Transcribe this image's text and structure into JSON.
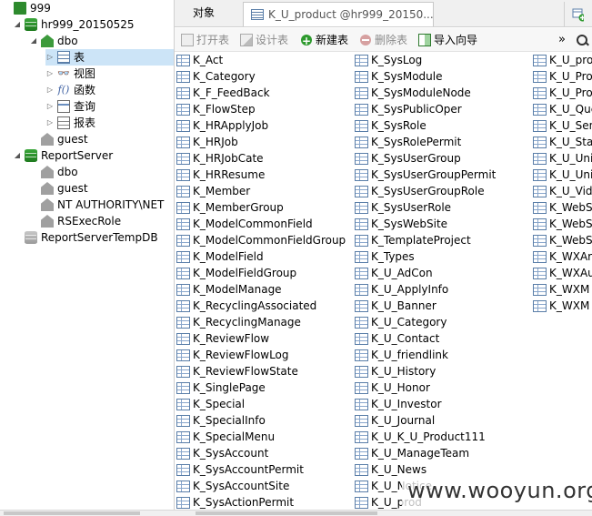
{
  "tree": {
    "nodes": [
      {
        "label": "999",
        "icon": "server-icon",
        "depth": 0,
        "expander": "none"
      },
      {
        "label": "hr999_20150525",
        "icon": "database-icon",
        "depth": 1,
        "expander": "open"
      },
      {
        "label": "dbo",
        "icon": "schema-icon",
        "depth": 2,
        "expander": "open"
      },
      {
        "label": "表",
        "icon": "table-icon",
        "depth": 3,
        "expander": "closed",
        "selected": true
      },
      {
        "label": "视图",
        "icon": "view-icon",
        "depth": 3,
        "expander": "closed"
      },
      {
        "label": "函数",
        "icon": "function-icon",
        "depth": 3,
        "expander": "closed"
      },
      {
        "label": "查询",
        "icon": "query-icon",
        "depth": 3,
        "expander": "closed"
      },
      {
        "label": "报表",
        "icon": "report-icon",
        "depth": 3,
        "expander": "closed"
      },
      {
        "label": "guest",
        "icon": "schema-icon",
        "depth": 2,
        "expander": "none"
      },
      {
        "label": "ReportServer",
        "icon": "database-icon",
        "depth": 1,
        "expander": "open"
      },
      {
        "label": "dbo",
        "icon": "schema-icon",
        "depth": 2,
        "expander": "none"
      },
      {
        "label": "guest",
        "icon": "schema-icon",
        "depth": 2,
        "expander": "none"
      },
      {
        "label": "NT AUTHORITY\\NET",
        "icon": "schema-icon",
        "depth": 2,
        "expander": "none"
      },
      {
        "label": "RSExecRole",
        "icon": "schema-icon",
        "depth": 2,
        "expander": "none"
      },
      {
        "label": "ReportServerTempDB",
        "icon": "database-icon",
        "depth": 1,
        "expander": "none"
      }
    ]
  },
  "tabs": {
    "objects_label": "对象",
    "product_tab_label": "K_U_product @hr999_20150..."
  },
  "toolbar": {
    "open_table": "打开表",
    "design_table": "设计表",
    "new_table": "新建表",
    "delete_table": "删除表",
    "import_wizard": "导入向导",
    "more": "»"
  },
  "objects": {
    "col1": [
      "K_Act",
      "K_Category",
      "K_F_FeedBack",
      "K_FlowStep",
      "K_HRApplyJob",
      "K_HRJob",
      "K_HRJobCate",
      "K_HRResume",
      "K_Member",
      "K_MemberGroup",
      "K_ModelCommonField",
      "K_ModelCommonFieldGroup",
      "K_ModelField",
      "K_ModelFieldGroup",
      "K_ModelManage",
      "K_RecyclingAssociated",
      "K_RecyclingManage",
      "K_ReviewFlow",
      "K_ReviewFlowLog",
      "K_ReviewFlowState",
      "K_SinglePage",
      "K_Special",
      "K_SpecialInfo",
      "K_SpecialMenu",
      "K_SysAccount",
      "K_SysAccountPermit",
      "K_SysAccountSite",
      "K_SysActionPermit"
    ],
    "col2": [
      "K_SysLog",
      "K_SysModule",
      "K_SysModuleNode",
      "K_SysPublicOper",
      "K_SysRole",
      "K_SysRolePermit",
      "K_SysUserGroup",
      "K_SysUserGroupPermit",
      "K_SysUserGroupRole",
      "K_SysUserRole",
      "K_SysWebSite",
      "K_TemplateProject",
      "K_Types",
      "K_U_AdCon",
      "K_U_ApplyInfo",
      "K_U_Banner",
      "K_U_Category",
      "K_U_Contact",
      "K_U_friendlink",
      "K_U_History",
      "K_U_Honor",
      "K_U_Investor",
      "K_U_Journal",
      "K_U_K_U_Product111",
      "K_U_ManageTeam",
      "K_U_News",
      "K_U_Notice",
      "K_U_prod"
    ],
    "col3": [
      "K_U_pro",
      "K_U_Pro",
      "K_U_Pro",
      "K_U_Que",
      "K_U_Sen",
      "K_U_Stat",
      "K_U_Uni",
      "K_U_Uni",
      "K_U_Vid",
      "K_WebS",
      "K_WebS",
      "K_WebS",
      "K_WXAr",
      "K_WXAu",
      "K_WXM",
      "K_WXM"
    ]
  },
  "watermark": "www.wooyun.org"
}
